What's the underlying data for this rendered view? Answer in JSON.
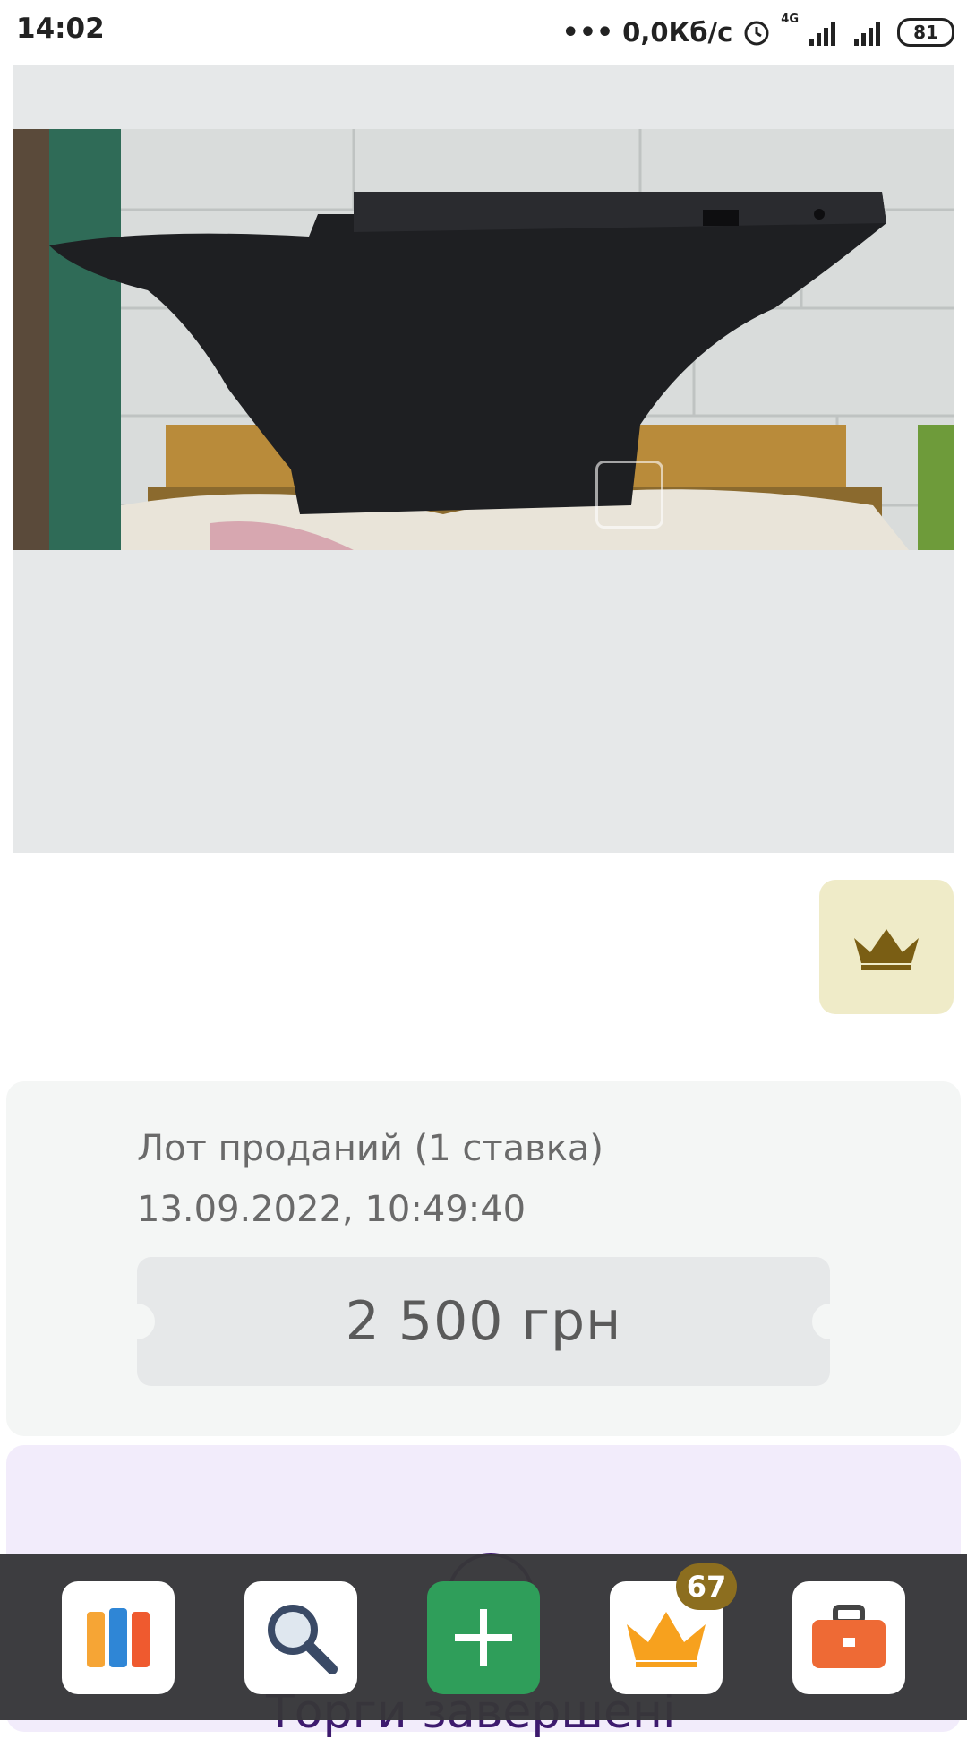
{
  "status_bar": {
    "time": "14:02",
    "speed": "0,0Кб/с",
    "network": "4G",
    "battery": "81"
  },
  "lot": {
    "status": "Лот проданий (1 ставка)",
    "date": "13.09.2022, 10:49:40",
    "price": "2 500 грн"
  },
  "auction": {
    "status_text": "Торги завершені"
  },
  "bottom_nav": {
    "badge_count": "67",
    "icons": [
      "books-icon",
      "search-icon",
      "add-icon",
      "crown-icon",
      "briefcase-icon"
    ]
  },
  "colors": {
    "accent_gold": "#8c6e1f",
    "crown_bg": "#efebc8",
    "add_green": "#2f9e5a",
    "auction_text": "#3d1a6e"
  }
}
